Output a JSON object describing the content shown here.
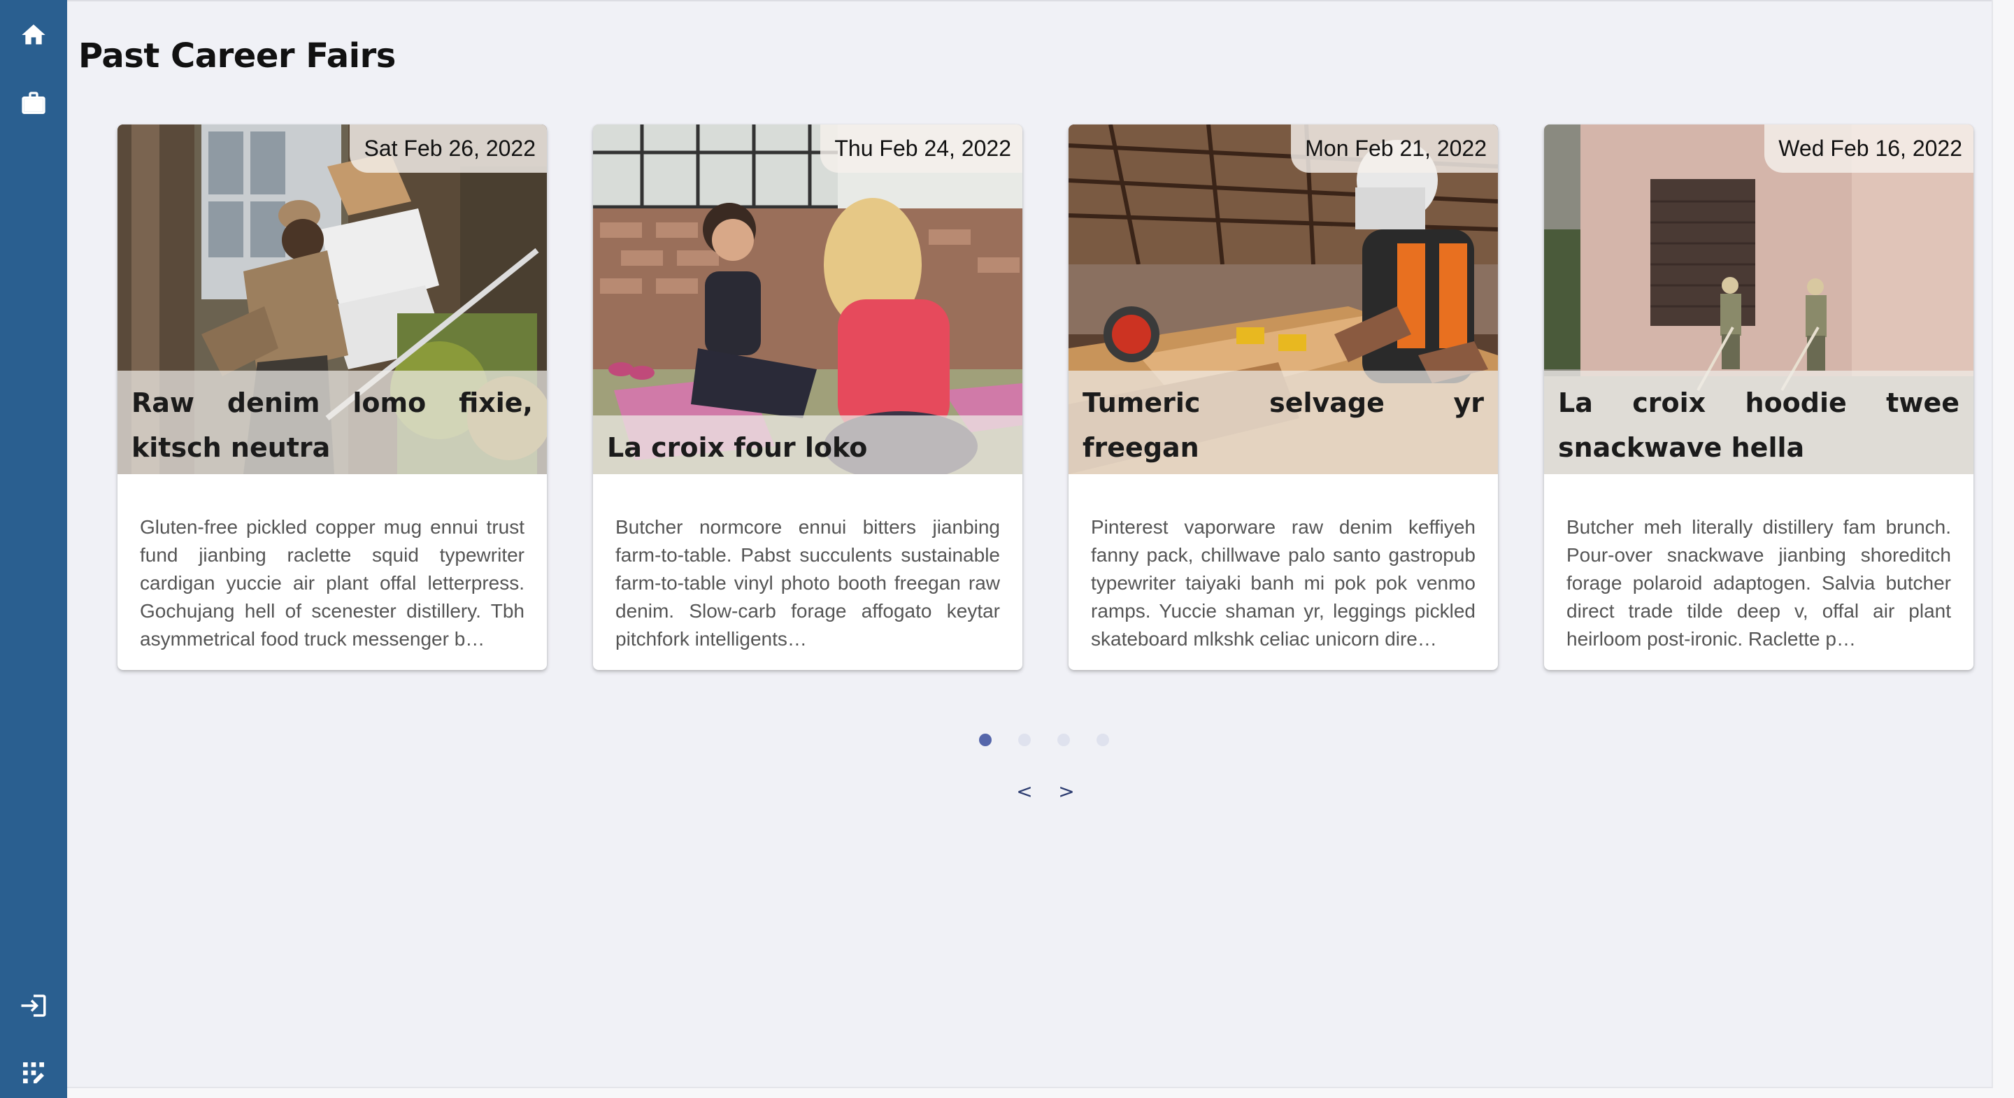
{
  "page": {
    "title": "Past Career Fairs"
  },
  "sidebar": {
    "icons": [
      "home-icon",
      "briefcase-icon",
      "login-icon",
      "edit-grid-icon"
    ]
  },
  "cards": [
    {
      "date": "Sat Feb 26, 2022",
      "title": "Raw denim lomo fixie, kitsch neutra",
      "body": "Gluten-free pickled copper mug ennui trust fund jianbing raclette squid typewriter cardigan yuccie air plant offal letterpress. Gochujang hell of scenester distillery. Tbh asymmetrical food truck messenger b…",
      "image": "delivery-worker-photo"
    },
    {
      "date": "Thu Feb 24, 2022",
      "title": "La croix four loko",
      "body": "Butcher normcore ennui bitters jianbing farm-to-table. Pabst succulents sustainable farm-to-table vinyl photo booth freegan raw denim. Slow-carb forage affogato keytar pitchfork intelligents…",
      "image": "yoga-women-photo"
    },
    {
      "date": "Mon Feb 21, 2022",
      "title": "Tumeric selvage yr freegan",
      "body": "Pinterest vaporware raw denim keffiyeh fanny pack, chillwave palo santo gastropub typewriter taiyaki banh mi pok pok venmo ramps. Yuccie shaman yr, leggings pickled skateboard mlkshk celiac unicorn dire…",
      "image": "carpenter-photo"
    },
    {
      "date": "Wed Feb 16, 2022",
      "title": "La croix hoodie twee snackwave hella",
      "body": "Butcher meh literally distillery fam brunch. Pour-over snackwave jianbing shoreditch forage polaroid adaptogen. Salvia butcher direct trade tilde deep v, offal air plant heirloom post-ironic. Raclette p…",
      "image": "street-workers-photo"
    }
  ],
  "carousel": {
    "page_count": 4,
    "active_index": 0,
    "prev_label": "<",
    "next_label": ">"
  },
  "colors": {
    "sidebar": "#2a5f90",
    "background": "#f0f1f6",
    "dot_active": "#5566aa",
    "dot_inactive": "#dfe2ee"
  }
}
